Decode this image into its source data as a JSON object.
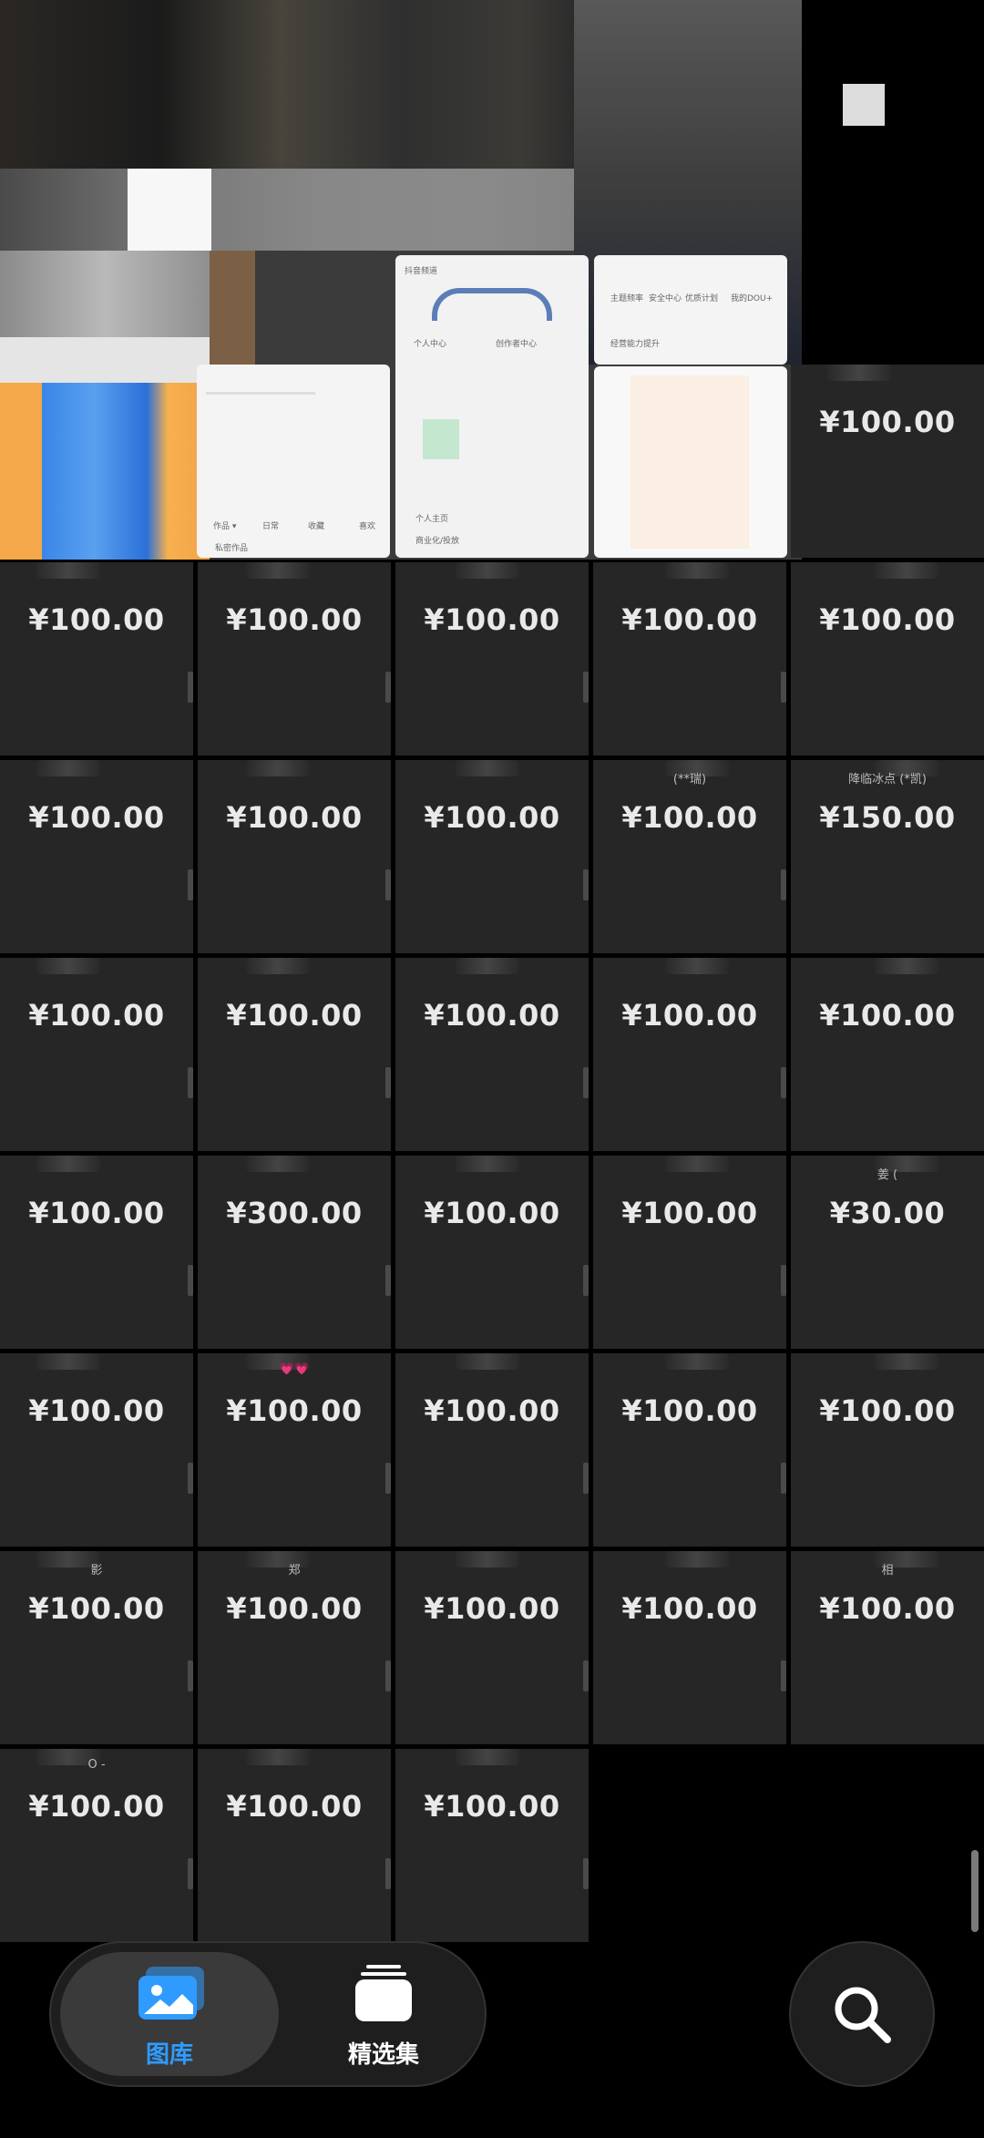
{
  "grid": {
    "rows": [
      [
        {
          "price": "¥100.00",
          "cap": ""
        }
      ],
      [
        {
          "price": "¥100.00",
          "cap": ""
        },
        {
          "price": "¥100.00",
          "cap": ""
        },
        {
          "price": "¥100.00",
          "cap": ""
        },
        {
          "price": "¥100.00",
          "cap": ""
        },
        {
          "price": "¥100.00",
          "cap": ""
        }
      ],
      [
        {
          "price": "¥100.00",
          "cap": ""
        },
        {
          "price": "¥100.00",
          "cap": ""
        },
        {
          "price": "¥100.00",
          "cap": ""
        },
        {
          "price": "¥100.00",
          "cap": "(**瑞)"
        },
        {
          "price": "¥150.00",
          "cap": "降临冰点 (*凯)"
        }
      ],
      [
        {
          "price": "¥100.00",
          "cap": ""
        },
        {
          "price": "¥100.00",
          "cap": ""
        },
        {
          "price": "¥100.00",
          "cap": ""
        },
        {
          "price": "¥100.00",
          "cap": ""
        },
        {
          "price": "¥100.00",
          "cap": ""
        }
      ],
      [
        {
          "price": "¥100.00",
          "cap": ""
        },
        {
          "price": "¥300.00",
          "cap": ""
        },
        {
          "price": "¥100.00",
          "cap": ""
        },
        {
          "price": "¥100.00",
          "cap": ""
        },
        {
          "price": "¥30.00",
          "cap": "姜 ("
        }
      ],
      [
        {
          "price": "¥100.00",
          "cap": ""
        },
        {
          "price": "¥100.00",
          "cap": "💗💗"
        },
        {
          "price": "¥100.00",
          "cap": ""
        },
        {
          "price": "¥100.00",
          "cap": ""
        },
        {
          "price": "¥100.00",
          "cap": ""
        }
      ],
      [
        {
          "price": "¥100.00",
          "cap": "影"
        },
        {
          "price": "¥100.00",
          "cap": "郑"
        },
        {
          "price": "¥100.00",
          "cap": ""
        },
        {
          "price": "¥100.00",
          "cap": ""
        },
        {
          "price": "¥100.00",
          "cap": "相"
        }
      ],
      [
        {
          "price": "¥100.00",
          "cap": "O -"
        },
        {
          "price": "¥100.00",
          "cap": ""
        },
        {
          "price": "¥100.00",
          "cap": ""
        }
      ]
    ]
  },
  "mosaic": {
    "screen_texts": [
      "作品 ▾",
      "日常",
      "收藏",
      "喜欢",
      "私密作品",
      "个人主页",
      "商业化/投放",
      "主题频率",
      "安全中心",
      "优质计划",
      "我的DOU+",
      "经营能力提升",
      "抖音频道",
      "个人中心",
      "创作者中心"
    ]
  },
  "bottom_nav": {
    "tabs": [
      {
        "label": "图库",
        "icon": "gallery-icon",
        "active": true
      },
      {
        "label": "精选集",
        "icon": "collection-icon",
        "active": false
      }
    ],
    "search_icon": "search-icon"
  },
  "colors": {
    "active_tab": "#2f9bff",
    "inactive_tab": "#ffffff",
    "tile_bg": "#262626",
    "page_bg": "#000000"
  }
}
